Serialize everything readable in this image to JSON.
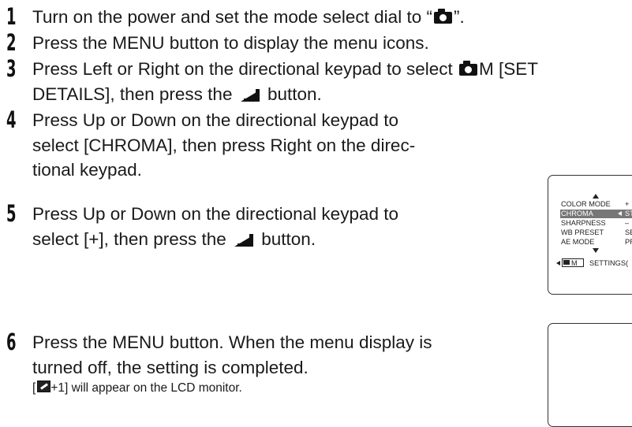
{
  "steps": [
    {
      "num": "1",
      "a": "Turn on the power and set the mode select dial to “",
      "b": "”."
    },
    {
      "num": "2",
      "text": "Press the MENU button to display the menu icons."
    },
    {
      "num": "3",
      "line1a": "Press Left or Right on the directional keypad to select ",
      "line1b": "M [SET",
      "line2a": "DETAILS], then press the ",
      "line2b": " button."
    },
    {
      "num": "4",
      "line1": "Press Up or Down on the directional keypad to",
      "line2": "select [CHROMA], then press Right on the direc-",
      "line3": "tional keypad."
    },
    {
      "num": "5",
      "line1": "Press Up or Down on the directional keypad to",
      "line2a": "select [+], then press the ",
      "line2b": " button."
    },
    {
      "num": "6",
      "line1": "Press the MENU button. When the menu display is",
      "line2": "turned off, the setting is completed.",
      "note_a": "[",
      "note_b": "+1] will appear on the LCD monitor."
    }
  ],
  "lcd_menu": {
    "rows": [
      {
        "label": "COLOR MODE",
        "value": "+"
      },
      {
        "label": "CHROMA",
        "value": "STA"
      },
      {
        "label": "SHARPNESS",
        "value": "–"
      },
      {
        "label": "WB PRESET",
        "value": "SET"
      },
      {
        "label": "AE MODE",
        "value": "PRO"
      }
    ],
    "footer_mode": "M",
    "footer_text": "SETTINGS("
  },
  "icons": [
    "camera-icon",
    "ok-button-icon",
    "menu-up-arrow-icon",
    "menu-down-arrow-icon",
    "left-arrow-icon",
    "color-setting-icon"
  ]
}
